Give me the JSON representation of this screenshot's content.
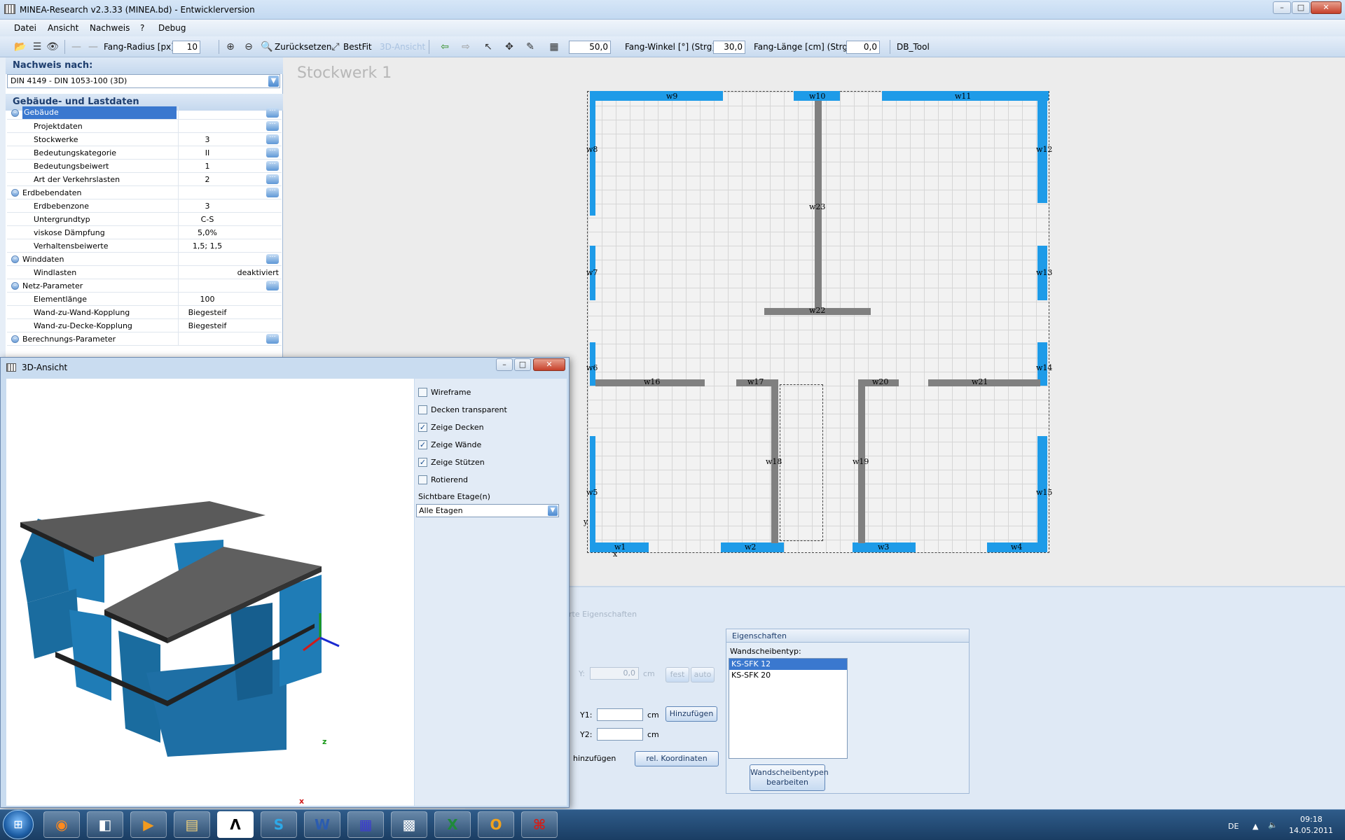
{
  "window": {
    "title": "MINEA-Research v2.3.33 (MINEA.bd) - Entwicklerversion",
    "minimize": "–",
    "maximize": "□",
    "close": "✕"
  },
  "menu": [
    "Datei",
    "Ansicht",
    "Nachweis",
    "?",
    "Debug"
  ],
  "toolbar": {
    "fang_radius_label": "Fang-Radius [px]:",
    "fang_radius_value": "10",
    "zuruecksetzen": "Zurücksetzen",
    "bestfit": "BestFit",
    "ansicht3d": "3D-Ansicht",
    "grid_value": "50,0",
    "fang_winkel_label": "Fang-Winkel [°] (Strg):",
    "fang_winkel_value": "30,0",
    "fang_laenge_label": "Fang-Länge [cm] (Strg):",
    "fang_laenge_value": "0,0",
    "db_tool": "DB_Tool"
  },
  "left_panel": {
    "nachweis_header": "Nachweis nach:",
    "nachweis_value": "DIN 4149 - DIN 1053-100 (3D)",
    "gebaeude_header": "Gebäude- und Lastdaten",
    "rows": [
      {
        "label": "Gebäude",
        "value": "",
        "level": 0,
        "dots": true,
        "selected": true
      },
      {
        "label": "Projektdaten",
        "value": "",
        "level": 1,
        "dots": true
      },
      {
        "label": "Stockwerke",
        "value": "3",
        "level": 1,
        "dots": true
      },
      {
        "label": "Bedeutungskategorie",
        "value": "II",
        "level": 1,
        "dots": true
      },
      {
        "label": "Bedeutungsbeiwert",
        "value": "1",
        "level": 1,
        "dots": true
      },
      {
        "label": "Art der Verkehrslasten",
        "value": "2",
        "level": 1,
        "dots": true
      },
      {
        "label": "Erdbebendaten",
        "value": "",
        "level": 0,
        "dots": true
      },
      {
        "label": "Erdbebenzone",
        "value": "3",
        "level": 1
      },
      {
        "label": "Untergrundtyp",
        "value": "C-S",
        "level": 1
      },
      {
        "label": "viskose Dämpfung",
        "value": "5,0%",
        "level": 1
      },
      {
        "label": "Verhaltensbeiwerte",
        "value": "1,5; 1,5",
        "level": 1
      },
      {
        "label": "Winddaten",
        "value": "",
        "level": 0,
        "dots": true
      },
      {
        "label": "Windlasten",
        "value": "deaktiviert",
        "level": 1,
        "right": true
      },
      {
        "label": "Netz-Parameter",
        "value": "",
        "level": 0,
        "dots": true
      },
      {
        "label": "Elementlänge",
        "value": "100",
        "level": 1
      },
      {
        "label": "Wand-zu-Wand-Kopplung",
        "value": "Biegesteif",
        "level": 1
      },
      {
        "label": "Wand-zu-Decke-Kopplung",
        "value": "Biegesteif",
        "level": 1
      },
      {
        "label": "Berechnungs-Parameter",
        "value": "",
        "level": 0,
        "dots": true
      }
    ]
  },
  "canvas": {
    "storey_title": "Stockwerk 1",
    "axis_y": "y",
    "axis_x": "x",
    "walls": [
      {
        "id": "w1",
        "kind": "blue"
      },
      {
        "id": "w2",
        "kind": "blue"
      },
      {
        "id": "w3",
        "kind": "blue"
      },
      {
        "id": "w4",
        "kind": "blue"
      },
      {
        "id": "w5",
        "kind": "blue"
      },
      {
        "id": "w6",
        "kind": "blue"
      },
      {
        "id": "w7",
        "kind": "blue"
      },
      {
        "id": "w8",
        "kind": "blue"
      },
      {
        "id": "w9",
        "kind": "blue"
      },
      {
        "id": "w10",
        "kind": "blue"
      },
      {
        "id": "w11",
        "kind": "blue"
      },
      {
        "id": "w12",
        "kind": "blue"
      },
      {
        "id": "w13",
        "kind": "blue"
      },
      {
        "id": "w14",
        "kind": "blue"
      },
      {
        "id": "w15",
        "kind": "blue"
      },
      {
        "id": "w16",
        "kind": "gray"
      },
      {
        "id": "w17",
        "kind": "gray"
      },
      {
        "id": "w18",
        "kind": "gray"
      },
      {
        "id": "w19",
        "kind": "gray"
      },
      {
        "id": "w20",
        "kind": "gray"
      },
      {
        "id": "w21",
        "kind": "gray"
      },
      {
        "id": "w22",
        "kind": "gray"
      },
      {
        "id": "w23",
        "kind": "gray"
      }
    ]
  },
  "bottom": {
    "tab_label": "rte Eigenschaften",
    "y_label": "Y:",
    "y_value": "0,0",
    "cm": "cm",
    "fest": "fest",
    "auto": "auto",
    "y1_label": "Y1:",
    "y2_label": "Y2:",
    "hinzufuegen": "Hinzufügen",
    "hinzufuegen_text": "hinzufügen",
    "rel_koordinaten": "rel. Koordinaten",
    "eigenschaften_header": "Eigenschaften",
    "wandscheibentyp_label": "Wandscheibentyp:",
    "wandscheibentypen": [
      "KS-SFK 12",
      "KS-SFK 20"
    ],
    "wandscheibentypen_btn": "Wandscheibentypen bearbeiten"
  },
  "dialog3d": {
    "title": "3D-Ansicht",
    "options": [
      {
        "label": "Wireframe",
        "checked": false
      },
      {
        "label": "Decken transparent",
        "checked": false
      },
      {
        "label": "Zeige Decken",
        "checked": true
      },
      {
        "label": "Zeige Wände",
        "checked": true
      },
      {
        "label": "Zeige Stützen",
        "checked": true
      },
      {
        "label": "Rotierend",
        "checked": false
      }
    ],
    "etage_label": "Sichtbare Etage(n)",
    "etage_value": "Alle Etagen",
    "axis_z": "z",
    "axis_x": "x"
  },
  "taskbar": {
    "lang": "DE",
    "time": "09:18",
    "date": "14.05.2011"
  },
  "colors": {
    "wall_blue": "#1e9be8",
    "wall_gray": "#808080",
    "selection": "#3a78cf"
  }
}
